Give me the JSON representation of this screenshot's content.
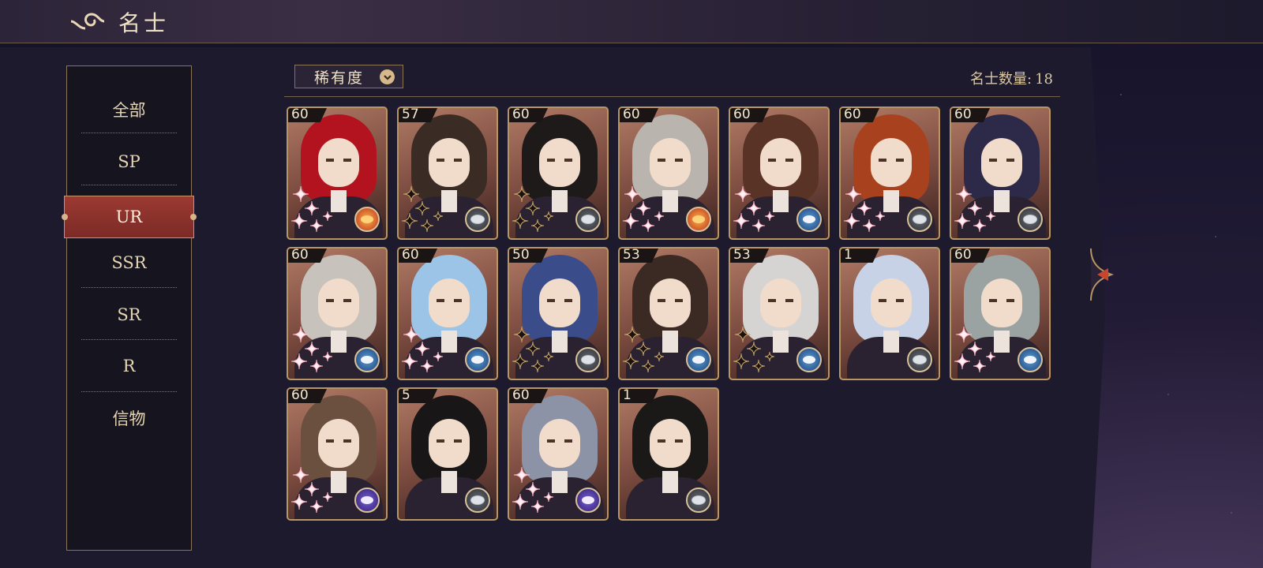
{
  "header": {
    "title": "名士"
  },
  "sidebar": {
    "items": [
      {
        "label": "全部"
      },
      {
        "label": "SP"
      },
      {
        "label": "UR",
        "active": true
      },
      {
        "label": "SSR"
      },
      {
        "label": "SR"
      },
      {
        "label": "R"
      },
      {
        "label": "信物"
      }
    ]
  },
  "toolbar": {
    "filter_label": "稀有度",
    "count_label": "名士数量:",
    "count_value": "18"
  },
  "cards": [
    {
      "level": "60",
      "hair": "#b3121f",
      "emblem": "gold",
      "stars": "pink"
    },
    {
      "level": "57",
      "hair": "#3a2c24",
      "emblem": "gray",
      "stars": "gold"
    },
    {
      "level": "60",
      "hair": "#1e1a1a",
      "emblem": "gray",
      "stars": "gold"
    },
    {
      "level": "60",
      "hair": "#b9b4ad",
      "emblem": "gold",
      "stars": "pink"
    },
    {
      "level": "60",
      "hair": "#5a3327",
      "emblem": "blue",
      "stars": "pink"
    },
    {
      "level": "60",
      "hair": "#a8421e",
      "emblem": "gray",
      "stars": "pink"
    },
    {
      "level": "60",
      "hair": "#2c2a48",
      "emblem": "gray",
      "stars": "pink"
    },
    {
      "level": "60",
      "hair": "#c8c2bc",
      "emblem": "blue",
      "stars": "pink"
    },
    {
      "level": "60",
      "hair": "#9cc4e6",
      "emblem": "blue",
      "stars": "pink"
    },
    {
      "level": "50",
      "hair": "#3a4d8a",
      "emblem": "gray",
      "stars": "gold"
    },
    {
      "level": "53",
      "hair": "#3b2a24",
      "emblem": "blue",
      "stars": "gold"
    },
    {
      "level": "53",
      "hair": "#d6d4d2",
      "emblem": "blue",
      "stars": "gold"
    },
    {
      "level": "1",
      "hair": "#c7d2e6",
      "emblem": "gray",
      "stars": "none"
    },
    {
      "level": "60",
      "hair": "#9aa3a2",
      "emblem": "blue",
      "stars": "pink"
    },
    {
      "level": "60",
      "hair": "#6b5040",
      "emblem": "purple",
      "stars": "pink"
    },
    {
      "level": "5",
      "hair": "#181616",
      "emblem": "gray",
      "stars": "none"
    },
    {
      "level": "60",
      "hair": "#8d93a6",
      "emblem": "purple",
      "stars": "pink"
    },
    {
      "level": "1",
      "hair": "#1b1818",
      "emblem": "gray",
      "stars": "none"
    }
  ]
}
